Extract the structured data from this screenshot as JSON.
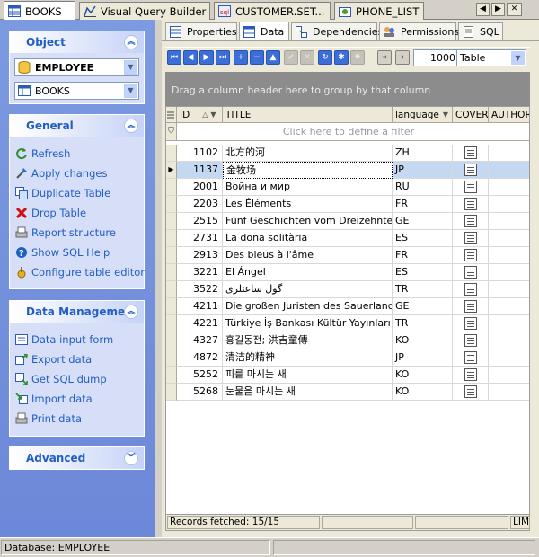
{
  "doc_tabs": [
    {
      "label": "BOOKS",
      "icon": "table-icon",
      "active": true
    },
    {
      "label": "Visual Query Builder",
      "icon": "query-builder-icon",
      "active": false
    },
    {
      "label": "CUSTOMER.SET...",
      "icon": "sql-script-icon",
      "active": false
    },
    {
      "label": "PHONE_LIST",
      "icon": "view-icon",
      "active": false
    }
  ],
  "doc_nav": {
    "prev": "◀",
    "next": "▶",
    "close": "✕"
  },
  "object_group": {
    "title": "Object",
    "database_value": "EMPLOYEE",
    "table_value": "BOOKS"
  },
  "general_group": {
    "title": "General",
    "items": [
      {
        "label": "Refresh",
        "icon": "refresh-icon"
      },
      {
        "label": "Apply changes",
        "icon": "apply-changes-icon"
      },
      {
        "label": "Duplicate Table",
        "icon": "duplicate-table-icon"
      },
      {
        "label": "Drop Table",
        "icon": "drop-table-icon"
      },
      {
        "label": "Report structure",
        "icon": "report-icon"
      },
      {
        "label": "Show SQL Help",
        "icon": "help-icon"
      },
      {
        "label": "Configure table editor",
        "icon": "configure-icon"
      }
    ]
  },
  "data_group": {
    "title": "Data Management",
    "items": [
      {
        "label": "Data input form",
        "icon": "input-form-icon"
      },
      {
        "label": "Export data",
        "icon": "export-icon"
      },
      {
        "label": "Get SQL dump",
        "icon": "sql-dump-icon"
      },
      {
        "label": "Import data",
        "icon": "import-icon"
      },
      {
        "label": "Print data",
        "icon": "print-icon"
      }
    ]
  },
  "advanced_group": {
    "title": "Advanced"
  },
  "prop_tabs": [
    {
      "label": "Properties",
      "icon": "properties-icon",
      "active": false
    },
    {
      "label": "Data",
      "icon": "data-icon",
      "active": true
    },
    {
      "label": "Dependencies",
      "icon": "dependencies-icon",
      "active": false
    },
    {
      "label": "Permissions",
      "icon": "permissions-icon",
      "active": false
    },
    {
      "label": "SQL",
      "icon": "sql-icon",
      "active": false
    }
  ],
  "navigator": {
    "record_count": "1000",
    "view_mode": "Table"
  },
  "group_panel_text": "Drag a column header here to group by that column",
  "filter_text": "Click here to define a filter",
  "columns": [
    "ID",
    "TITLE",
    "language",
    "COVER",
    "AUTHOR_"
  ],
  "rows": [
    {
      "id": "1102",
      "title": "北方的河",
      "lang": "ZH"
    },
    {
      "id": "1137",
      "title": "金牧场",
      "lang": "JP",
      "selected": true
    },
    {
      "id": "2001",
      "title": "Война и мир",
      "lang": "RU"
    },
    {
      "id": "2203",
      "title": "Les Éléments",
      "lang": "FR"
    },
    {
      "id": "2515",
      "title": "Fünf Geschichten vom Dreizehnten",
      "lang": "GE"
    },
    {
      "id": "2731",
      "title": "La dona solitària",
      "lang": "ES"
    },
    {
      "id": "2913",
      "title": "Des bleus à l'âme",
      "lang": "FR"
    },
    {
      "id": "3221",
      "title": "El Ángel",
      "lang": "ES"
    },
    {
      "id": "3522",
      "title": "گول ساعتلری",
      "lang": "TR"
    },
    {
      "id": "4211",
      "title": "Die großen Juristen des Sauerlandes",
      "lang": "GE"
    },
    {
      "id": "4221",
      "title": "Türkiye İş Bankası Kültür Yayınları",
      "lang": "TR"
    },
    {
      "id": "4327",
      "title": "홍길동전; 洪吉童傳",
      "lang": "KO"
    },
    {
      "id": "4872",
      "title": "清洁的精神",
      "lang": "JP"
    },
    {
      "id": "5252",
      "title": "피를 마시는 새",
      "lang": "KO"
    },
    {
      "id": "5268",
      "title": "눈물을 마시는 새",
      "lang": "KO"
    }
  ],
  "footer": {
    "records": "Records fetched: 15/15",
    "limit": "LIMI"
  },
  "status": {
    "database": "Database: EMPLOYEE"
  }
}
